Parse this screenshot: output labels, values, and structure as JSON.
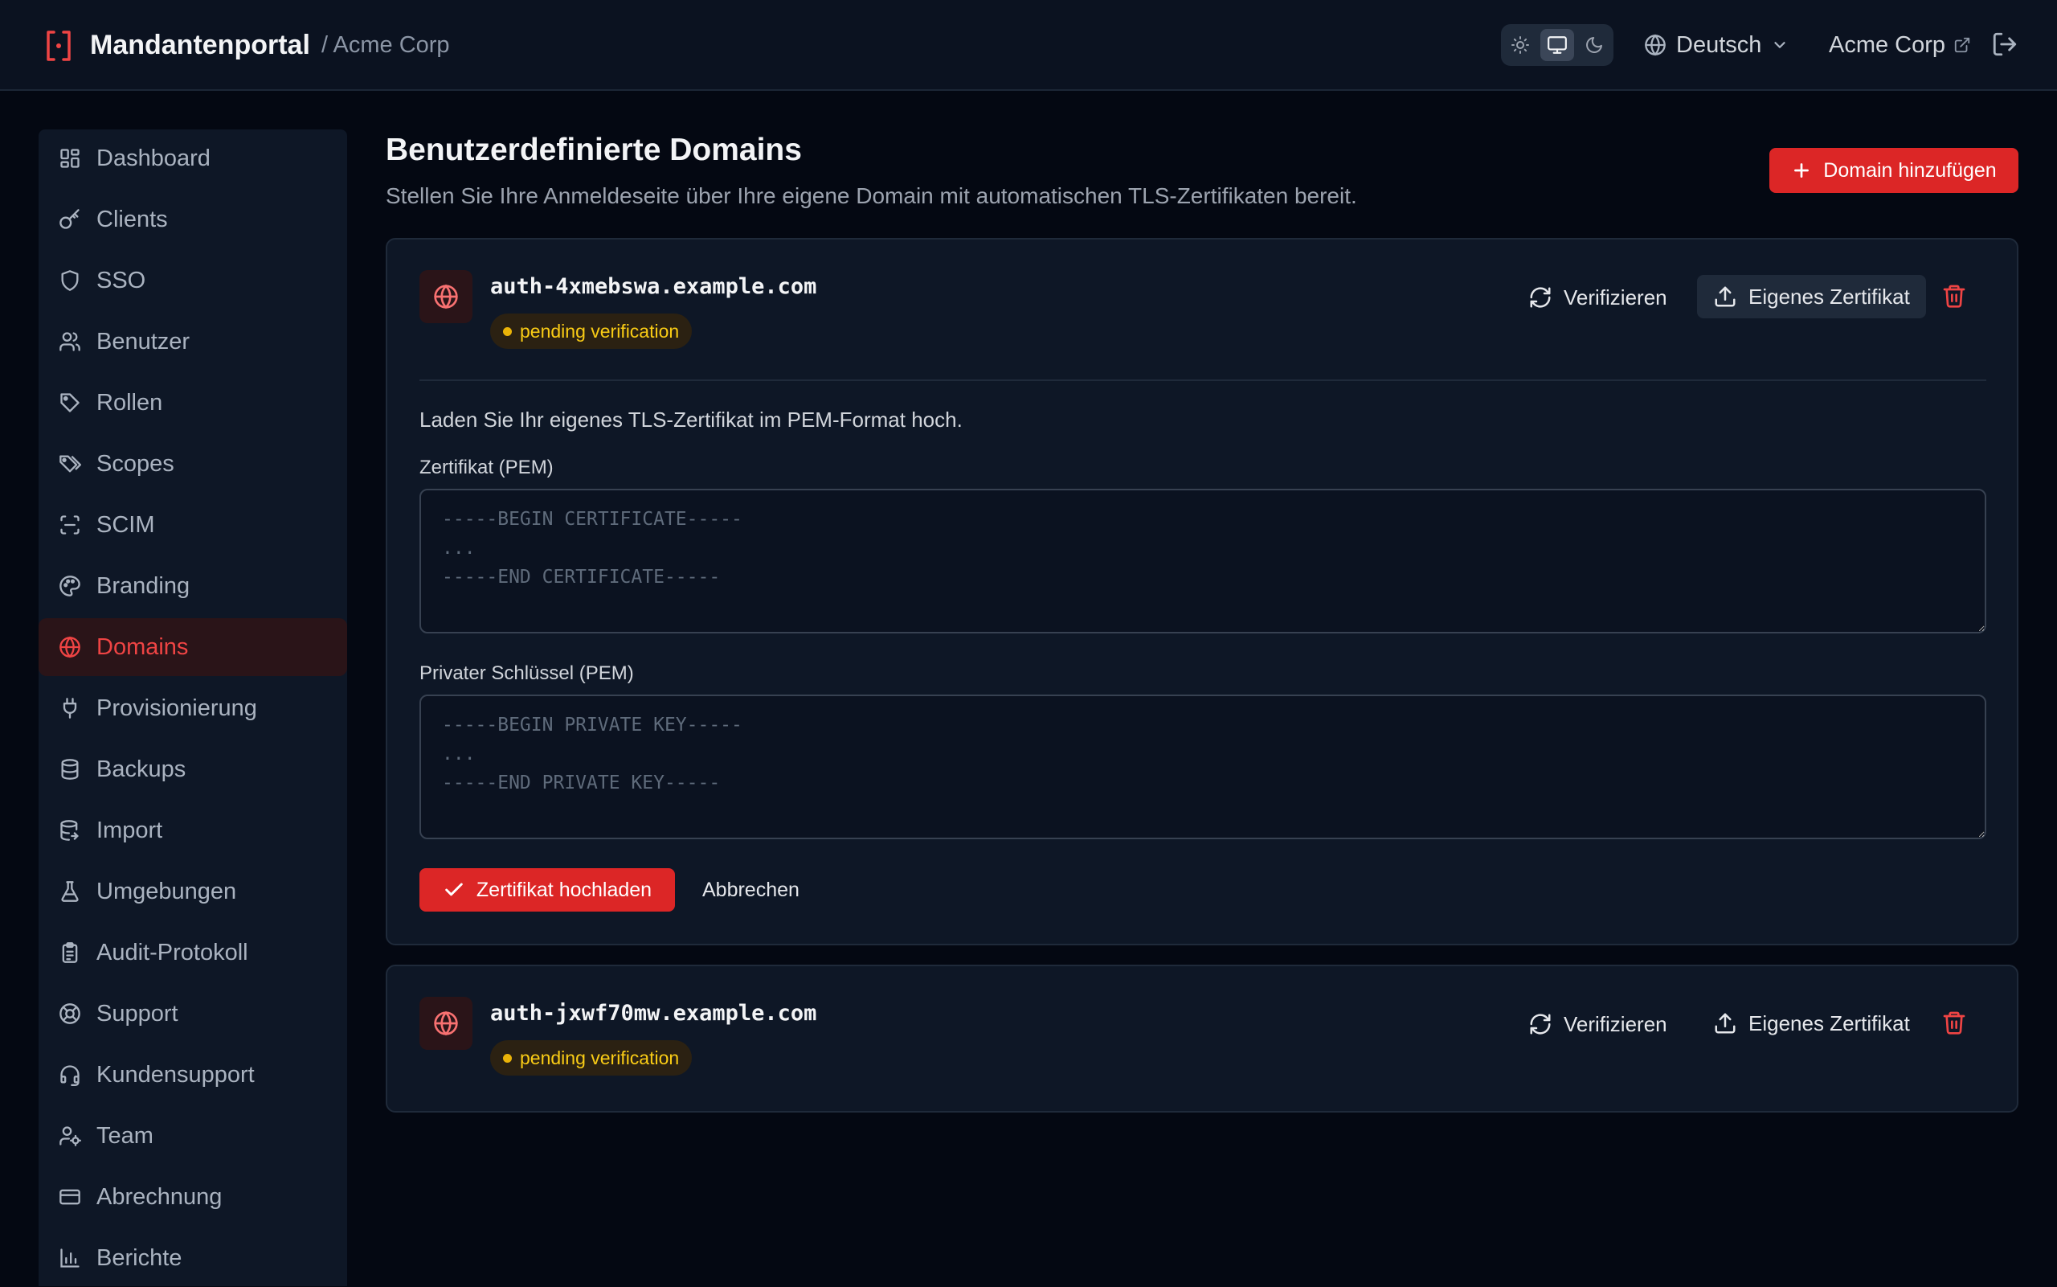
{
  "header": {
    "app_title": "Mandantenportal",
    "tenant_crumb": "/ Acme Corp",
    "theme_options": [
      "light-icon",
      "system-icon",
      "dark-icon"
    ],
    "theme_selected": "system",
    "language": "Deutsch",
    "tenant_link": "Acme Corp"
  },
  "colors": {
    "accent": "#dc2626",
    "accent_text": "#ef4444",
    "warning": "#facc15",
    "background": "#040812",
    "surface": "#0e1726"
  },
  "sidebar": {
    "items": [
      {
        "label": "Dashboard",
        "icon": "dashboard-icon"
      },
      {
        "label": "Clients",
        "icon": "key-icon"
      },
      {
        "label": "SSO",
        "icon": "shield-icon"
      },
      {
        "label": "Benutzer",
        "icon": "users-icon"
      },
      {
        "label": "Rollen",
        "icon": "tag-icon"
      },
      {
        "label": "Scopes",
        "icon": "tags-icon"
      },
      {
        "label": "SCIM",
        "icon": "scan-icon"
      },
      {
        "label": "Branding",
        "icon": "palette-icon"
      },
      {
        "label": "Domains",
        "icon": "globe-icon",
        "active": true
      },
      {
        "label": "Provisionierung",
        "icon": "plug-icon"
      },
      {
        "label": "Backups",
        "icon": "database-icon"
      },
      {
        "label": "Import",
        "icon": "database-import-icon"
      },
      {
        "label": "Umgebungen",
        "icon": "flask-icon"
      },
      {
        "label": "Audit-Protokoll",
        "icon": "clipboard-icon"
      },
      {
        "label": "Support",
        "icon": "life-buoy-icon"
      },
      {
        "label": "Kundensupport",
        "icon": "headset-icon"
      },
      {
        "label": "Team",
        "icon": "user-cog-icon"
      },
      {
        "label": "Abrechnung",
        "icon": "credit-card-icon"
      },
      {
        "label": "Berichte",
        "icon": "bar-chart-icon"
      }
    ]
  },
  "main": {
    "title": "Benutzerdefinierte Domains",
    "subtitle": "Stellen Sie Ihre Anmeldeseite über Ihre eigene Domain mit automatischen TLS-Zertifikaten bereit.",
    "add_button": "Domain hinzufügen",
    "domains": [
      {
        "name": "auth-4xmebswa.example.com",
        "status": "pending verification",
        "verify_label": "Verifizieren",
        "cert_label": "Eigenes Zertifikat",
        "upload": {
          "intro": "Laden Sie Ihr eigenes TLS-Zertifikat im PEM-Format hoch.",
          "cert_label": "Zertifikat (PEM)",
          "cert_placeholder": "-----BEGIN CERTIFICATE-----\n...\n-----END CERTIFICATE-----",
          "cert_value": "",
          "key_label": "Privater Schlüssel (PEM)",
          "key_placeholder": "-----BEGIN PRIVATE KEY-----\n...\n-----END PRIVATE KEY-----",
          "key_value": "",
          "submit_label": "Zertifikat hochladen",
          "cancel_label": "Abbrechen"
        }
      },
      {
        "name": "auth-jxwf70mw.example.com",
        "status": "pending verification",
        "verify_label": "Verifizieren",
        "cert_label": "Eigenes Zertifikat"
      }
    ]
  }
}
